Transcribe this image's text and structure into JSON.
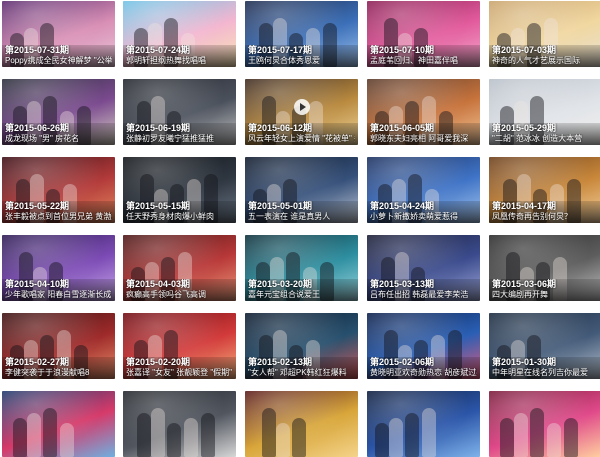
{
  "tiles": [
    {
      "period": "第2015-07-31期",
      "title": "Poppy携成全民女神解梦 \"公举病\"",
      "colors": [
        "#5a2a6e",
        "#d98fb5",
        "#e9c7d9"
      ],
      "play": false
    },
    {
      "period": "第2015-07-24期",
      "title": "郭明轩担纲热舞找唱唱",
      "colors": [
        "#6ec3e6",
        "#f3b6d0",
        "#f9e6b4"
      ],
      "play": false
    },
    {
      "period": "第2015-07-17期",
      "title": "王鸥何炅合体秀恩爱",
      "colors": [
        "#1d2b4e",
        "#3b6fb8",
        "#9fc3ee"
      ],
      "play": false
    },
    {
      "period": "第2015-07-10期",
      "title": "孟庭苇回归、神田嘉伴唱",
      "colors": [
        "#8b1d54",
        "#e25b9c",
        "#f4a9cc"
      ],
      "play": false
    },
    {
      "period": "第2015-07-03期",
      "title": "神奇的人气才艺展示国际",
      "colors": [
        "#c9a36b",
        "#f1d7a0",
        "#e8e1d3"
      ],
      "play": false
    },
    {
      "period": "第2015-06-26期",
      "title": "成龙现场 \"男\" 房花名",
      "colors": [
        "#2a2f3a",
        "#7b4a8f",
        "#d8d0c4"
      ],
      "play": false
    },
    {
      "period": "第2015-06-19期",
      "title": "张静初罗友曦宁猛推猛推",
      "colors": [
        "#23262d",
        "#4b515c",
        "#c8c8c8"
      ],
      "play": false
    },
    {
      "period": "第2015-06-12期",
      "title": "风云年轻女上演爱情 \"花被单\" 秀",
      "colors": [
        "#3d2a1f",
        "#b98a3f",
        "#f0d59b"
      ],
      "play": true
    },
    {
      "period": "第2015-06-05期",
      "title": "郭晓东夫妇亮相 阿哥爱我深",
      "colors": [
        "#5a3a2a",
        "#c7733c",
        "#f2c79a"
      ],
      "play": false
    },
    {
      "period": "第2015-05-29期",
      "title": "\"二胡\" 范冰冰 创造大本营",
      "colors": [
        "#b8bfc8",
        "#dfe3e8",
        "#f3f1ee"
      ],
      "play": false
    },
    {
      "period": "第2015-05-22期",
      "title": "张丰毅被点到首位男兄弟 黄渤热情搞笑全能",
      "colors": [
        "#3a0d14",
        "#b23a3a",
        "#e58a5e"
      ],
      "play": false
    },
    {
      "period": "第2015-05-15期",
      "title": "任天野秀身材肉爆小鲜肉",
      "colors": [
        "#111418",
        "#2e3640",
        "#6b7786"
      ],
      "play": false
    },
    {
      "period": "第2015-05-01期",
      "title": "五一表演在 谁是真男人",
      "colors": [
        "#0f1a2c",
        "#35507a",
        "#c2cbd8"
      ],
      "play": false
    },
    {
      "period": "第2015-04-24期",
      "title": "小萝卜新撒娇卖萌爱惹得",
      "colors": [
        "#1b2f5e",
        "#3f73c6",
        "#a8c8ee"
      ],
      "play": false
    },
    {
      "period": "第2015-04-17期",
      "title": "凤凰传奇再告别何炅？",
      "colors": [
        "#6b3e1a",
        "#c8873a",
        "#f4d1a0"
      ],
      "play": false
    },
    {
      "period": "第2015-04-10期",
      "title": "少年歌唱家 阳春白雪逐渐长成",
      "colors": [
        "#2c1a52",
        "#7c4bb5",
        "#c9a9ea"
      ],
      "play": false
    },
    {
      "period": "第2015-04-03期",
      "title": "疯癫高手领吗谷飞高调",
      "colors": [
        "#4a1515",
        "#b83838",
        "#ec9a7a"
      ],
      "play": false
    },
    {
      "period": "第2015-03-20期",
      "title": "嘉年元宝组合说爱王",
      "colors": [
        "#0c2f3a",
        "#2e8fa0",
        "#9ed6df"
      ],
      "play": false
    },
    {
      "period": "第2015-03-13期",
      "title": "吕布任出招 韩磊最爱李荣浩",
      "colors": [
        "#1a1d35",
        "#3a4a8c",
        "#a0a9d9"
      ],
      "play": false
    },
    {
      "period": "第2015-03-06期",
      "title": "四大编剧再开舞",
      "colors": [
        "#2a2a2a",
        "#5d5d5d",
        "#c4c4c4"
      ],
      "play": false
    },
    {
      "period": "第2015-02-27期",
      "title": "李健突袭于于浪漫献唱8",
      "colors": [
        "#3a1010",
        "#9e2a2a",
        "#e88f6a"
      ],
      "play": false
    },
    {
      "period": "第2015-02-20期",
      "title": "张嘉译 \"女友\" 张靓颖登 \"假期\"",
      "colors": [
        "#6e0b12",
        "#d23a3a",
        "#f5b27e"
      ],
      "play": false
    },
    {
      "period": "第2015-02-13期",
      "title": "\"女人帮\" 邓超PK韩红狂爆料",
      "colors": [
        "#0b1a2e",
        "#27506e",
        "#d25a5a"
      ],
      "play": false
    },
    {
      "period": "第2015-02-06期",
      "title": "黄晓明亚欢奇勋热恋 胡彦斌过感情",
      "colors": [
        "#0b1f4a",
        "#2a5fb5",
        "#e25b7a"
      ],
      "play": false
    },
    {
      "period": "第2015-01-30期",
      "title": "中年明星在线名列吉你最爱",
      "colors": [
        "#1a2a3e",
        "#435a78",
        "#b8c3d0"
      ],
      "play": false
    },
    {
      "period": "",
      "title": "",
      "colors": [
        "#1d3a6e",
        "#d63a6a",
        "#6fb0e0"
      ],
      "play": false
    },
    {
      "period": "",
      "title": "",
      "colors": [
        "#23262c",
        "#50555e",
        "#d7d7d7"
      ],
      "play": false
    },
    {
      "period": "",
      "title": "",
      "colors": [
        "#5a1a1a",
        "#d8a63a",
        "#f4d38a"
      ],
      "play": false
    },
    {
      "period": "",
      "title": "",
      "colors": [
        "#0e1e3e",
        "#2b55a8",
        "#7fb2ea"
      ],
      "play": false
    },
    {
      "period": "",
      "title": "",
      "colors": [
        "#7a1a3a",
        "#e04a8a",
        "#ffd0a0"
      ],
      "play": false
    }
  ]
}
